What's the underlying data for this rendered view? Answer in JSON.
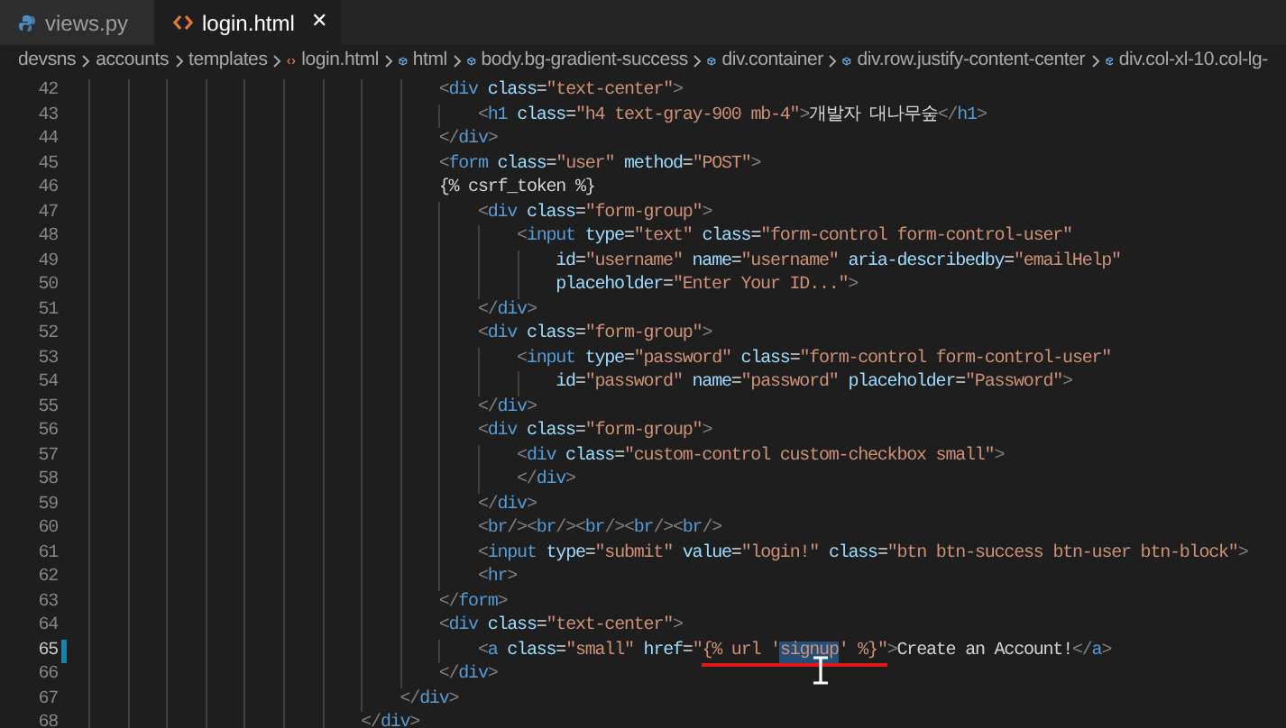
{
  "tabs": [
    {
      "label": "views.py",
      "kind": "python",
      "selected": false
    },
    {
      "label": "login.html",
      "kind": "html",
      "selected": true,
      "close": "✕"
    }
  ],
  "breadcrumb": [
    {
      "label": "devsns",
      "kind": "folder"
    },
    {
      "label": "accounts",
      "kind": "folder"
    },
    {
      "label": "templates",
      "kind": "folder"
    },
    {
      "label": "login.html",
      "kind": "file"
    },
    {
      "label": "html",
      "kind": "symbol"
    },
    {
      "label": "body.bg-gradient-success",
      "kind": "symbol"
    },
    {
      "label": "div.container",
      "kind": "symbol"
    },
    {
      "label": "div.row.justify-content-center",
      "kind": "symbol"
    },
    {
      "label": "div.col-xl-10.col-lg-",
      "kind": "symbol"
    }
  ],
  "editor": {
    "lines": [
      {
        "number": "42",
        "modified": false,
        "segments": [
          {
            "text": "                                    <div class=\"text-center\">"
          }
        ]
      },
      {
        "number": "43",
        "modified": false,
        "segments": [
          {
            "text": "                                        <h1 class=\"h4 text-gray-900 mb-4\">개발자 대나무숲</h1>"
          }
        ]
      },
      {
        "number": "44",
        "modified": false,
        "segments": [
          {
            "text": "                                    </div>"
          }
        ]
      },
      {
        "number": "45",
        "modified": false,
        "segments": [
          {
            "text": "                                    <form class=\"user\" method=\"POST\">"
          }
        ]
      },
      {
        "number": "46",
        "modified": false,
        "segments": [
          {
            "text": "                                    {% csrf_token %}"
          }
        ]
      },
      {
        "number": "47",
        "modified": false,
        "segments": [
          {
            "text": "                                        <div class=\"form-group\">"
          }
        ]
      },
      {
        "number": "48",
        "modified": false,
        "segments": [
          {
            "text": "                                            <input type=\"text\" class=\"form-control form-control-user\""
          }
        ]
      },
      {
        "number": "49",
        "modified": false,
        "segments": [
          {
            "text": "                                                id=\"username\" name=\"username\" aria-describedby=\"emailHelp\""
          }
        ]
      },
      {
        "number": "50",
        "modified": false,
        "segments": [
          {
            "text": "                                                placeholder=\"Enter Your ID...\">"
          }
        ]
      },
      {
        "number": "51",
        "modified": false,
        "segments": [
          {
            "text": "                                        </div>"
          }
        ]
      },
      {
        "number": "52",
        "modified": false,
        "segments": [
          {
            "text": "                                        <div class=\"form-group\">"
          }
        ]
      },
      {
        "number": "53",
        "modified": false,
        "segments": [
          {
            "text": "                                            <input type=\"password\" class=\"form-control form-control-user\""
          }
        ]
      },
      {
        "number": "54",
        "modified": false,
        "segments": [
          {
            "text": "                                                id=\"password\" name=\"password\" placeholder=\"Password\">"
          }
        ]
      },
      {
        "number": "55",
        "modified": false,
        "segments": [
          {
            "text": "                                        </div>"
          }
        ]
      },
      {
        "number": "56",
        "modified": false,
        "segments": [
          {
            "text": "                                        <div class=\"form-group\">"
          }
        ]
      },
      {
        "number": "57",
        "modified": false,
        "segments": [
          {
            "text": "                                            <div class=\"custom-control custom-checkbox small\">"
          }
        ]
      },
      {
        "number": "58",
        "modified": false,
        "segments": [
          {
            "text": "                                            </div>"
          }
        ]
      },
      {
        "number": "59",
        "modified": false,
        "segments": [
          {
            "text": "                                        </div>"
          }
        ]
      },
      {
        "number": "60",
        "modified": false,
        "segments": [
          {
            "text": "                                        <br/><br/><br/><br/><br/>"
          }
        ]
      },
      {
        "number": "61",
        "modified": false,
        "segments": [
          {
            "text": "                                        <input type=\"submit\" value=\"login!\" class=\"btn btn-success btn-user btn-block\">"
          }
        ]
      },
      {
        "number": "62",
        "modified": false,
        "segments": [
          {
            "text": "                                        <hr>"
          }
        ]
      },
      {
        "number": "63",
        "modified": false,
        "segments": [
          {
            "text": "                                    </form>"
          }
        ]
      },
      {
        "number": "64",
        "modified": false,
        "segments": [
          {
            "text": "                                    <div class=\"text-center\">"
          }
        ]
      },
      {
        "number": "65",
        "modified": true,
        "segments": [
          {
            "text": "                                        <a class=\"small\" href=\"",
            "highlighted": false,
            "underlined": false
          },
          {
            "text": "{% url '",
            "highlighted": false,
            "underlined": true
          },
          {
            "text": "signup",
            "highlighted": true,
            "underlined": true
          },
          {
            "text": "' %}\"",
            "highlighted": false,
            "underlined": true
          },
          {
            "text": ">Create an Account!</a>",
            "highlighted": false,
            "underlined": false
          }
        ]
      },
      {
        "number": "66",
        "modified": false,
        "segments": [
          {
            "text": "                                    </div>"
          }
        ]
      },
      {
        "number": "67",
        "modified": false,
        "segments": [
          {
            "text": "                                </div>"
          }
        ]
      },
      {
        "number": "68",
        "modified": false,
        "segments": [
          {
            "text": "                            </div>"
          }
        ]
      }
    ]
  }
}
